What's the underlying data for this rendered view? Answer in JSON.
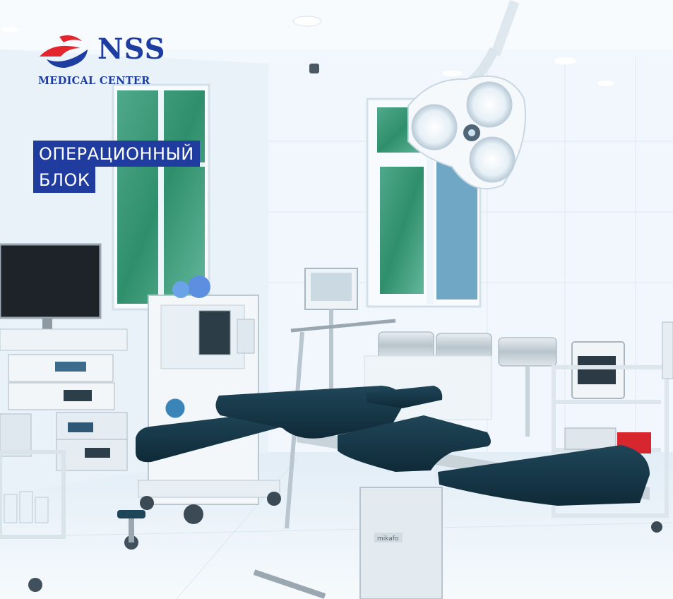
{
  "brand": {
    "name": "NSS",
    "subtitle": "MEDICAL CENTER",
    "primary_color": "#1e3da0",
    "accent_color": "#e3262e"
  },
  "caption": {
    "line1": "ОПЕРАЦИОННЫЙ",
    "line2": "БЛОК",
    "background": "#1f3c9e"
  },
  "equipment": {
    "table_label": "mikafo"
  }
}
